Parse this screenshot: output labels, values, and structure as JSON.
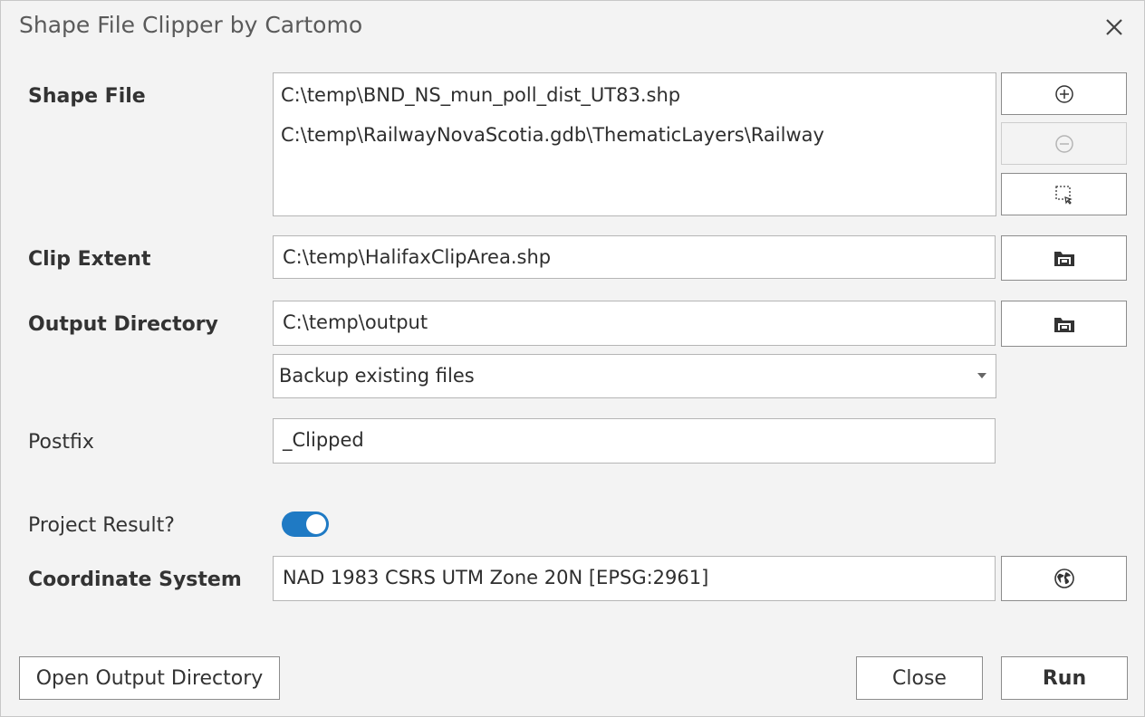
{
  "window": {
    "title": "Shape File Clipper by Cartomo"
  },
  "shape_file": {
    "label": "Shape File",
    "items": [
      "C:\\temp\\BND_NS_mun_poll_dist_UT83.shp",
      "C:\\temp\\RailwayNovaScotia.gdb\\ThematicLayers\\Railway"
    ]
  },
  "clip_extent": {
    "label": "Clip Extent",
    "value": "C:\\temp\\HalifaxClipArea.shp"
  },
  "output_directory": {
    "label": "Output Directory",
    "value": "C:\\temp\\output",
    "mode_selected": "Backup existing files"
  },
  "postfix": {
    "label": "Postfix",
    "value": "_Clipped"
  },
  "project_result": {
    "label": "Project Result?",
    "on": true
  },
  "coordinate_system": {
    "label": "Coordinate System",
    "value": "NAD 1983 CSRS UTM Zone 20N [EPSG:2961]"
  },
  "footer": {
    "open_output_label": "Open Output Directory",
    "close_label": "Close",
    "run_label": "Run"
  },
  "icons": {
    "add": "add-circle-icon",
    "remove": "remove-circle-icon",
    "select_from_map": "select-from-map-icon",
    "browse_folder": "folder-browse-icon",
    "globe": "globe-icon",
    "close": "close-icon"
  },
  "colors": {
    "toggle_on": "#1f7ac4",
    "background": "#f3f3f3"
  }
}
